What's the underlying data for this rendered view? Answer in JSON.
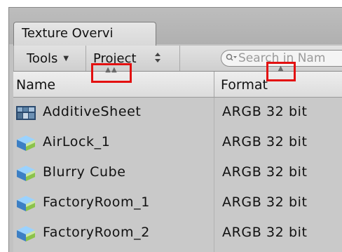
{
  "window": {
    "tab_title": "Texture Overvi"
  },
  "toolbar": {
    "tools_label": "Tools",
    "tools_arrow": "▼",
    "project_label": "Project",
    "project_arrows": "◆",
    "search_placeholder": "Search in Nam"
  },
  "columns": {
    "name_header": "Name",
    "format_header": "Format",
    "name_sort_glyph": "▲▲",
    "format_sort_glyph": "▲"
  },
  "rows": [
    {
      "name": "AdditiveSheet",
      "format": "ARGB 32 bit",
      "icon": "texture-thumbnail-icon"
    },
    {
      "name": "AirLock_1",
      "format": "ARGB 32 bit",
      "icon": "cubemap-icon"
    },
    {
      "name": "Blurry Cube",
      "format": "ARGB 32 bit",
      "icon": "cubemap-icon"
    },
    {
      "name": "FactoryRoom_1",
      "format": "ARGB 32 bit",
      "icon": "cubemap-icon"
    },
    {
      "name": "FactoryRoom_2",
      "format": "ARGB 32 bit",
      "icon": "cubemap-icon"
    }
  ],
  "colors": {
    "highlight": "#e31010"
  }
}
